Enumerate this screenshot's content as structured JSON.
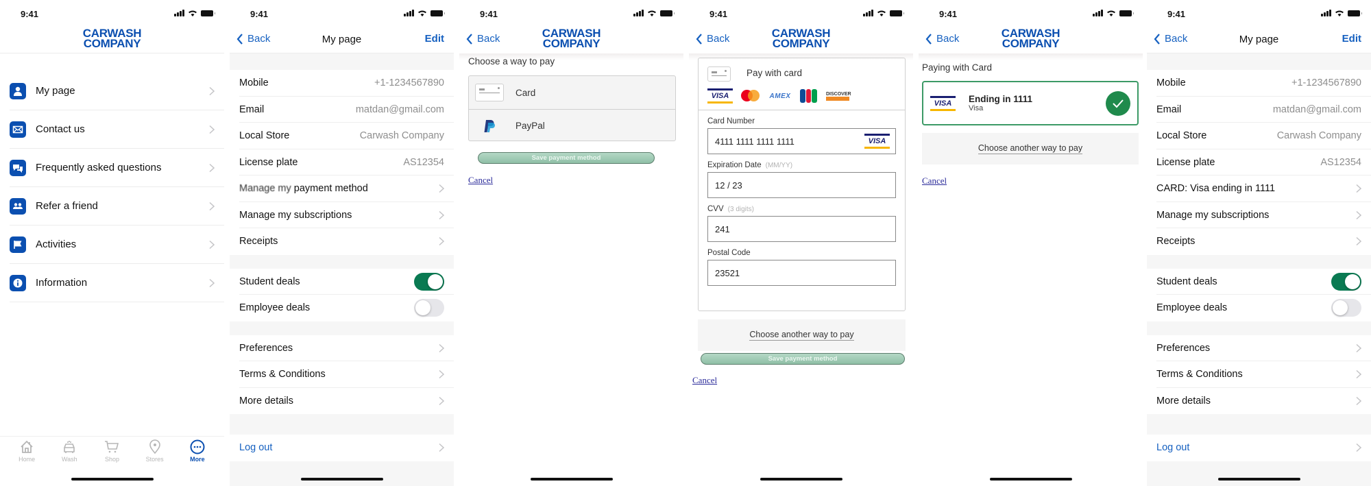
{
  "status_time": "9:41",
  "brand": {
    "line1": "CARWASH",
    "line2": "COMPANY",
    "color": "#0b4fb0"
  },
  "nav": {
    "back": "Back",
    "my_page_title": "My page",
    "edit": "Edit"
  },
  "menu_screen": {
    "items": [
      {
        "label": "My page",
        "icon": "person-icon"
      },
      {
        "label": "Contact us",
        "icon": "envelope-icon"
      },
      {
        "label": "Frequently asked questions",
        "icon": "chat-bubbles-icon"
      },
      {
        "label": "Refer a friend",
        "icon": "people-icon"
      },
      {
        "label": "Activities",
        "icon": "flag-icon"
      },
      {
        "label": "Information",
        "icon": "info-icon"
      }
    ],
    "tabs": [
      {
        "label": "Home",
        "icon": "home-icon",
        "active": false
      },
      {
        "label": "Wash",
        "icon": "car-wash-icon",
        "active": false
      },
      {
        "label": "Shop",
        "icon": "cart-icon",
        "active": false
      },
      {
        "label": "Stores",
        "icon": "location-pin-icon",
        "active": false
      },
      {
        "label": "More",
        "icon": "more-dots-icon",
        "active": true
      }
    ]
  },
  "profile": {
    "mobile_label": "Mobile",
    "mobile": "+1-1234567890",
    "email_label": "Email",
    "email": "matdan@gmail.com",
    "store_label": "Local Store",
    "store": "Carwash Company",
    "plate_label": "License plate",
    "plate": "AS12354",
    "payment_label_a": "Manage my",
    "payment_label_b": "payment method",
    "payment_saved_label": "CARD: Visa ending in 1111",
    "subscriptions_label": "Manage my subscriptions",
    "receipts_label": "Receipts",
    "student_deals_label": "Student deals",
    "student_deals_on": true,
    "employee_deals_label": "Employee deals",
    "employee_deals_on": false,
    "preferences_label": "Preferences",
    "terms_label": "Terms & Conditions",
    "more_details_label": "More details",
    "logout_label": "Log out"
  },
  "payment": {
    "choose_title": "Choose a way to pay",
    "options": [
      {
        "label": "Card",
        "icon": "credit-card-icon"
      },
      {
        "label": "PayPal",
        "icon": "paypal-icon"
      }
    ],
    "save_button": "Save payment method",
    "cancel": "Cancel",
    "pay_with_card": "Pay with card",
    "brands": [
      "VISA",
      "Mastercard",
      "AMEX",
      "JCB",
      "DISCOVER"
    ],
    "card_number_label": "Card Number",
    "card_number": "4111 1111 1111 1111",
    "expiry_label": "Expiration Date",
    "expiry_hint": "(MM/YY)",
    "expiry": "12 / 23",
    "cvv_label": "CVV",
    "cvv_hint": "(3 digits)",
    "cvv": "241",
    "postal_label": "Postal Code",
    "postal": "23521",
    "another_way": "Choose another way to pay",
    "paying_with": "Paying with Card",
    "ending": "Ending in 1111",
    "card_brand": "Visa",
    "visa_text": "VISA"
  },
  "colors": {
    "accent": "#1560c0",
    "toggle_on": "#0a7a52",
    "success": "#1f8a4c"
  }
}
